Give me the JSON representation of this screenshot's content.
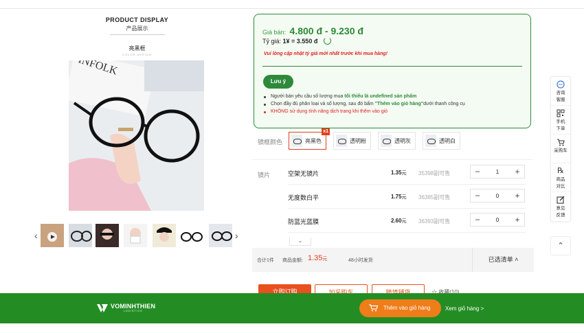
{
  "product_display": {
    "title": "PRODUCT DISPLAY",
    "subtitle": "产品展示",
    "name": "亮黑框",
    "name_sub": "COLOR DESIGN"
  },
  "popup": {
    "price_label": "Giá bán:",
    "price": "4.800 đ - 9.230 đ",
    "rate_label": "Tỷ giá:",
    "rate": "1¥ = 3.550 đ",
    "warning": "Vui lòng cập nhật tỷ giá mới nhất trước khi mua hàng!",
    "note_button": "Lưu ý",
    "note1_prefix": "Người bán yêu cầu số lượng mua ",
    "note1_bold": "tối thiểu là undefined sản phẩm",
    "note2_prefix": "Chọn đầy đủ phân loại và số lượng, sau đó bấm ",
    "note2_bold": "\"Thêm vào giỏ hàng\"",
    "note2_suffix": "dưới thanh công cụ",
    "note3": "KHÔNG sử dụng tính năng dịch trang khi thêm vào giỏ"
  },
  "options": {
    "frame_label": "镜框颜色",
    "colors": [
      {
        "label": "亮黑色",
        "selected": true,
        "badge": "x1"
      },
      {
        "label": "透明粉",
        "selected": false
      },
      {
        "label": "透明灰",
        "selected": false
      },
      {
        "label": "透明白",
        "selected": false
      }
    ],
    "lens_label": "镜片",
    "lenses": [
      {
        "name": "空架无镜片",
        "price": "1.35",
        "unit": "元",
        "stock": "35398副可售",
        "qty": "1"
      },
      {
        "name": "无度数白平",
        "price": "1.75",
        "unit": "元",
        "stock": "36385副可售",
        "qty": "0"
      },
      {
        "name": "防蓝光蓝膜",
        "price": "2.60",
        "unit": "元",
        "stock": "36393副可售",
        "qty": "0"
      }
    ]
  },
  "summary": {
    "total": "合计1件",
    "amount_label": "商品金额:",
    "amount": "1.35",
    "amount_unit": "元",
    "shipping": "48小时发货",
    "list_toggle": "已选清单"
  },
  "actions": {
    "buy": "立即订购",
    "add_cart": "加采购车",
    "book": "跨境铺货",
    "favorite": "收藏(10)"
  },
  "sidebar": {
    "items": [
      {
        "icon": "chat-icon",
        "glyph": "💬",
        "label1": "咨询",
        "label2": "客服"
      },
      {
        "icon": "qr-icon",
        "glyph": "▦",
        "label1": "手机",
        "label2": "下单"
      },
      {
        "icon": "cart-icon",
        "glyph": "🛒",
        "label1": "采购车",
        "label2": ""
      },
      {
        "icon": "compare-icon",
        "glyph": "℞",
        "label1": "商品",
        "label2": "对比"
      },
      {
        "icon": "edit-icon",
        "glyph": "✎",
        "label1": "意见",
        "label2": "反馈"
      }
    ]
  },
  "bottom_bar": {
    "logo_text": "VOMINHTHIEN",
    "logo_sub": "LOGISTICS",
    "cart_button": "Thêm vào giỏ hàng",
    "view_cart": "Xem giỏ hàng >"
  },
  "colors": {
    "green": "#238d24",
    "orange": "#ef7d1a",
    "red": "#e0401c"
  }
}
